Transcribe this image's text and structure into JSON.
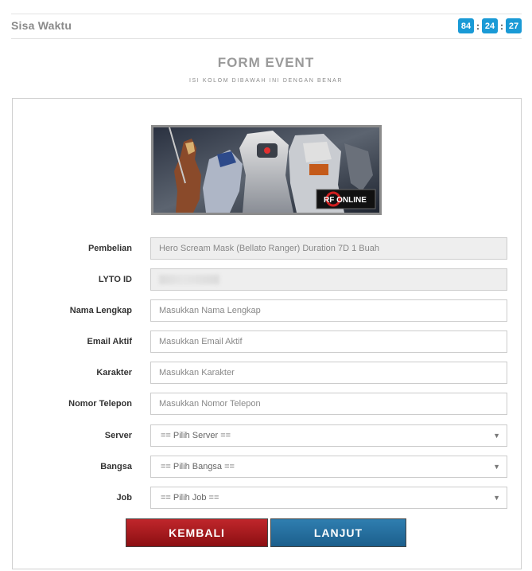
{
  "timer": {
    "label": "Sisa Waktu",
    "hours": "84",
    "minutes": "24",
    "seconds": "27",
    "separator": ":"
  },
  "form": {
    "title": "FORM EVENT",
    "subtitle": "ISI KOLOM DIBAWAH INI DENGAN BENAR",
    "banner_logo_text": "RF ONLINE",
    "fields": [
      {
        "label": "Pembelian",
        "value": "Hero Scream Mask (Bellato Ranger) Duration 7D 1 Buah"
      },
      {
        "label": "LYTO ID",
        "value": ""
      },
      {
        "label": "Nama Lengkap",
        "placeholder": "Masukkan Nama Lengkap"
      },
      {
        "label": "Email Aktif",
        "placeholder": "Masukkan Email Aktif"
      },
      {
        "label": "Karakter",
        "placeholder": "Masukkan Karakter"
      },
      {
        "label": "Nomor Telepon",
        "placeholder": "Masukkan Nomor Telepon"
      },
      {
        "label": "Server",
        "selected": "== Pilih Server =="
      },
      {
        "label": "Bangsa",
        "selected": "== Pilih Bangsa =="
      },
      {
        "label": "Job",
        "selected": "== Pilih Job =="
      }
    ],
    "buttons": {
      "back": "KEMBALI",
      "next": "LANJUT"
    }
  },
  "colors": {
    "timer_box": "#1a9ad6",
    "back_button": "#a81a1e",
    "next_button": "#256e9e"
  }
}
